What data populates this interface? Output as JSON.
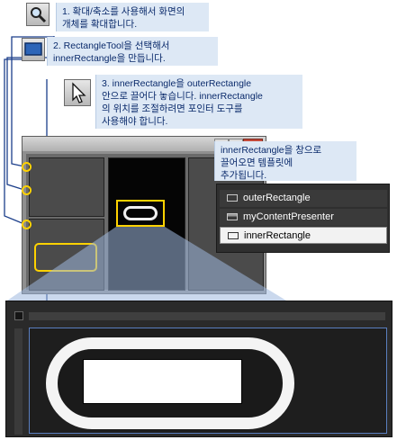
{
  "callouts": {
    "step1": "1. 확대/축소를 사용해서 화면의\n개체를 확대합니다.",
    "step2": "2. RectangleTool을 선택해서\ninnerRectangle을 만듭니다.",
    "step3": "3. innerRectangle을 outerRectangle\n안으로 끌어다 놓습니다. innerRectangle\n의 위치를 조절하려면 포인터 도구를\n사용해야 합니다.",
    "popup": "innerRectangle을 창으로\n끌어오면 템플릿에\n추가됩니다."
  },
  "window": {
    "controls": [
      "–",
      "□",
      "✕"
    ]
  },
  "tree": {
    "items": [
      {
        "label": "outerRectangle",
        "icon": "rectangle-icon",
        "selected": false
      },
      {
        "label": "myContentPresenter",
        "icon": "content-presenter-icon",
        "selected": false
      },
      {
        "label": "innerRectangle",
        "icon": "rectangle-icon",
        "selected": true
      }
    ]
  },
  "icons": {
    "zoom": "magnifier-icon",
    "rectangle_tool": "rectangle-tool-icon",
    "pointer": "pointer-arrow-icon"
  },
  "colors": {
    "callout_bg": "#dde8f5",
    "callout_text": "#0a2a6b",
    "highlight": "#ffd200",
    "dark_canvas": "#2b2b2b"
  }
}
